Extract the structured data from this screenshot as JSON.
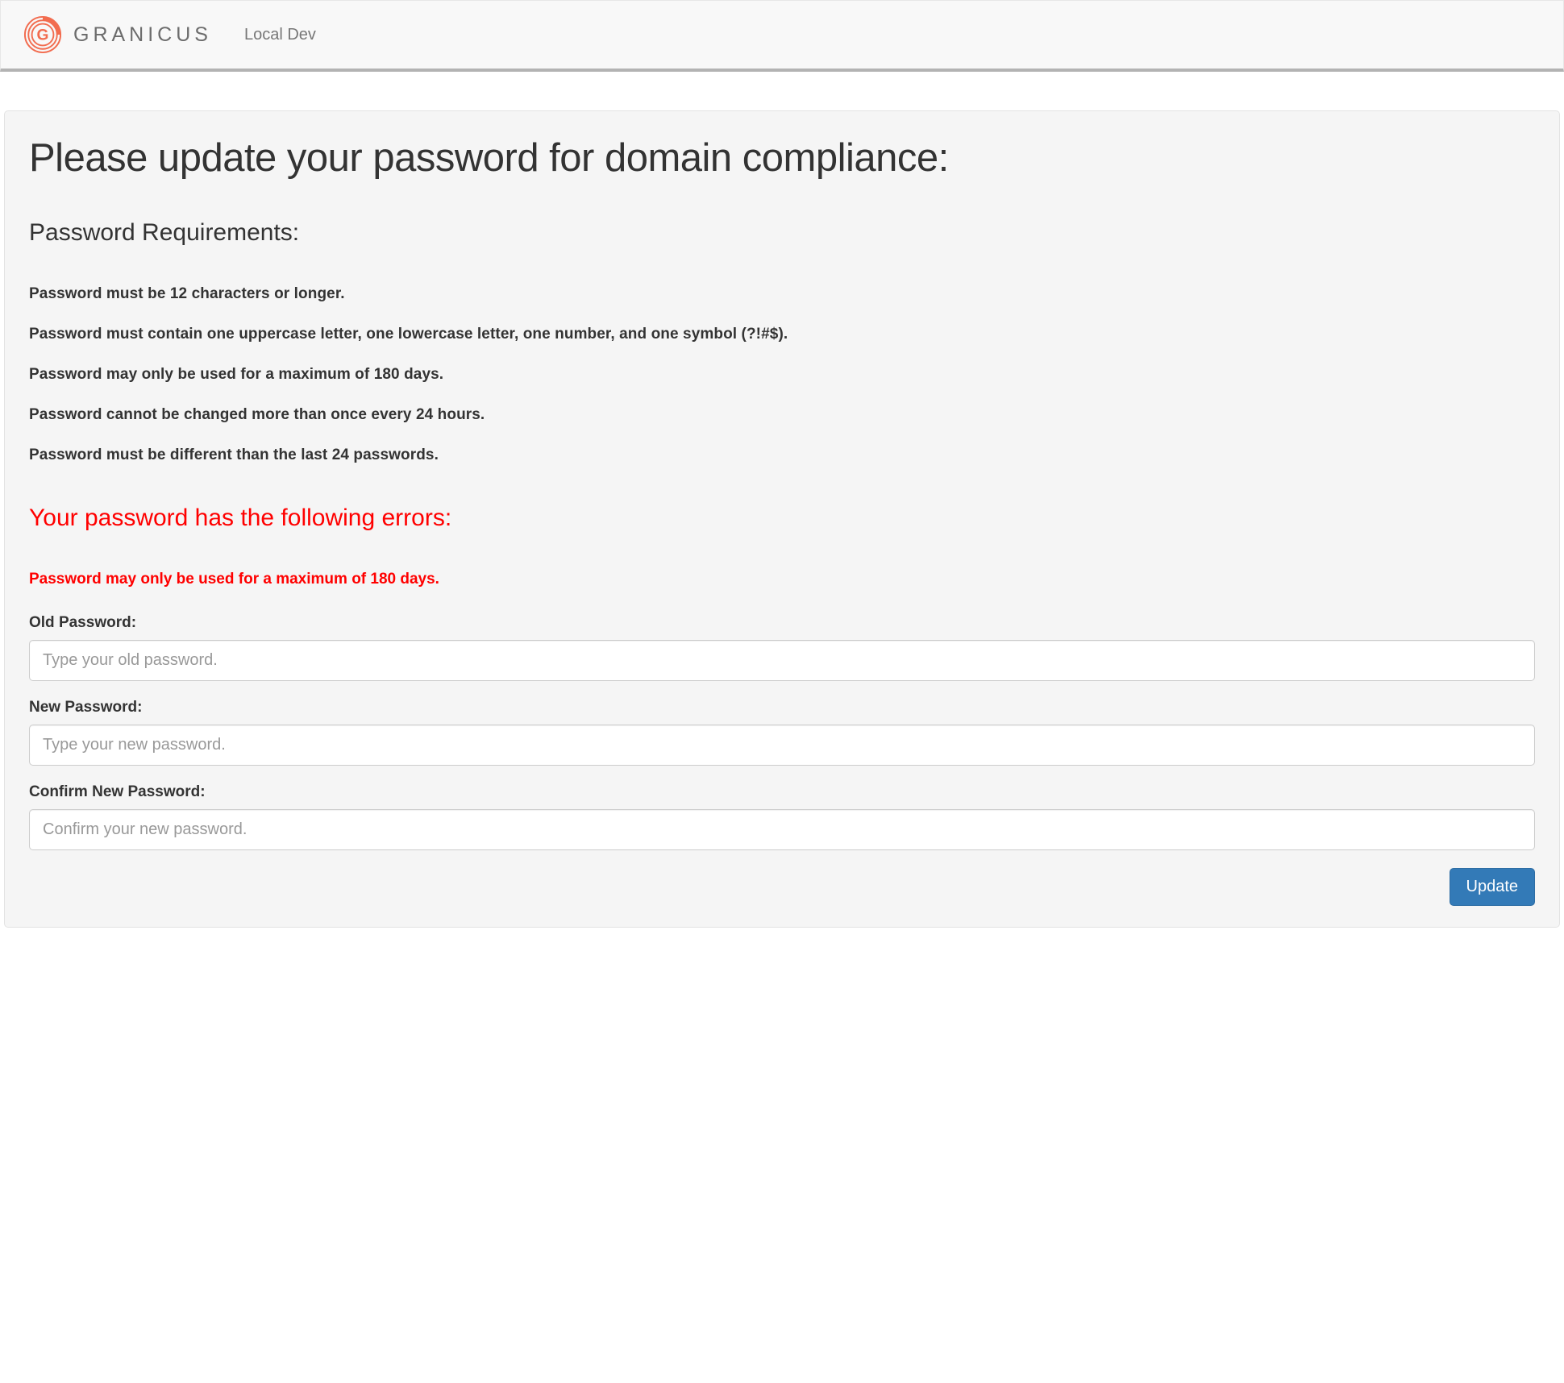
{
  "navbar": {
    "brand_text": "GRANICUS",
    "link_text": "Local Dev"
  },
  "page": {
    "title": "Please update your password for domain compliance:",
    "requirements_heading": "Password Requirements:",
    "requirements": [
      "Password must be 12 characters or longer.",
      "Password must contain one uppercase letter, one lowercase letter, one number, and one symbol (?!#$).",
      "Password may only be used for a maximum of 180 days.",
      "Password cannot be changed more than once every 24 hours.",
      "Password must be different than the last 24 passwords."
    ],
    "errors_heading": "Your password has the following errors:",
    "errors": [
      "Password may only be used for a maximum of 180 days."
    ]
  },
  "form": {
    "old_label": "Old Password:",
    "old_placeholder": "Type your old password.",
    "new_label": "New Password:",
    "new_placeholder": "Type your new password.",
    "confirm_label": "Confirm New Password:",
    "confirm_placeholder": "Confirm your new password.",
    "submit_label": "Update"
  }
}
